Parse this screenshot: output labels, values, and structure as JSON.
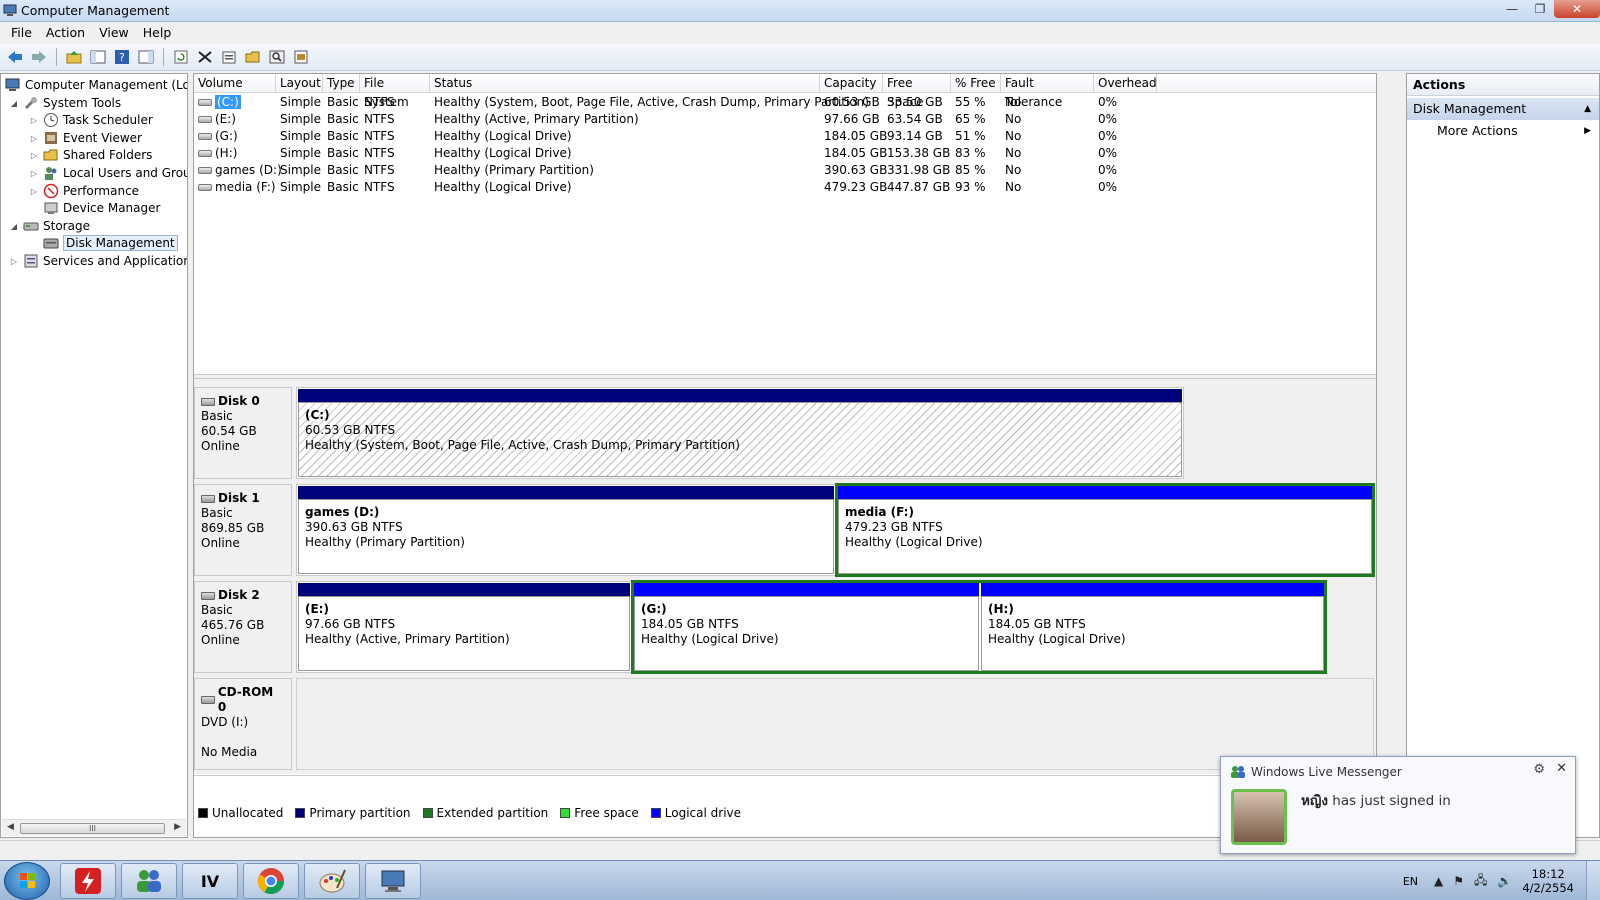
{
  "window": {
    "title": "Computer Management",
    "controls": {
      "minimize": "—",
      "maximize": "❐",
      "close": "✕"
    }
  },
  "menu": [
    "File",
    "Action",
    "View",
    "Help"
  ],
  "toolbar": {
    "icons": [
      "back-icon",
      "forward-icon",
      "up-folder-icon",
      "show-hide-tree-icon",
      "help-icon",
      "show-hide-action-pane-icon",
      "refresh-icon",
      "delete-icon",
      "properties-icon",
      "open-icon",
      "search-icon",
      "export-icon"
    ]
  },
  "tree": {
    "root": "Computer Management (Local",
    "system_tools": "System Tools",
    "task_scheduler": "Task Scheduler",
    "event_viewer": "Event Viewer",
    "shared_folders": "Shared Folders",
    "local_users": "Local Users and Groups",
    "performance": "Performance",
    "device_manager": "Device Manager",
    "storage": "Storage",
    "disk_management": "Disk Management",
    "services": "Services and Applications",
    "scroll_grip": "III"
  },
  "volumes": {
    "headers": [
      "Volume",
      "Layout",
      "Type",
      "File System",
      "Status",
      "Capacity",
      "Free Space",
      "% Free",
      "Fault Tolerance",
      "Overhead"
    ],
    "rows": [
      [
        "(C:)",
        "Simple",
        "Basic",
        "NTFS",
        "Healthy (System, Boot, Page File, Active, Crash Dump, Primary Partition)",
        "60.53 GB",
        "33.50 GB",
        "55 %",
        "No",
        "0%"
      ],
      [
        "(E:)",
        "Simple",
        "Basic",
        "NTFS",
        "Healthy (Active, Primary Partition)",
        "97.66 GB",
        "63.54 GB",
        "65 %",
        "No",
        "0%"
      ],
      [
        "(G:)",
        "Simple",
        "Basic",
        "NTFS",
        "Healthy (Logical Drive)",
        "184.05 GB",
        "93.14 GB",
        "51 %",
        "No",
        "0%"
      ],
      [
        "(H:)",
        "Simple",
        "Basic",
        "NTFS",
        "Healthy (Logical Drive)",
        "184.05 GB",
        "153.38 GB",
        "83 %",
        "No",
        "0%"
      ],
      [
        "games (D:)",
        "Simple",
        "Basic",
        "NTFS",
        "Healthy (Primary Partition)",
        "390.63 GB",
        "331.98 GB",
        "85 %",
        "No",
        "0%"
      ],
      [
        "media (F:)",
        "Simple",
        "Basic",
        "NTFS",
        "Healthy (Logical Drive)",
        "479.23 GB",
        "447.87 GB",
        "93 %",
        "No",
        "0%"
      ]
    ]
  },
  "disks": [
    {
      "name": "Disk 0",
      "type": "Basic",
      "size": "60.54 GB",
      "state": "Online",
      "partitions": [
        {
          "name": "(C:)",
          "size": "60.53 GB NTFS",
          "status": "Healthy (System, Boot, Page File, Active, Crash Dump, Primary Partition)",
          "kind": "primary"
        }
      ]
    },
    {
      "name": "Disk 1",
      "type": "Basic",
      "size": "869.85 GB",
      "state": "Online",
      "partitions": [
        {
          "name": "games  (D:)",
          "size": "390.63 GB NTFS",
          "status": "Healthy (Primary Partition)",
          "kind": "primary"
        },
        {
          "name": "media  (F:)",
          "size": "479.23 GB NTFS",
          "status": "Healthy (Logical Drive)",
          "kind": "logical"
        }
      ]
    },
    {
      "name": "Disk 2",
      "type": "Basic",
      "size": "465.76 GB",
      "state": "Online",
      "partitions": [
        {
          "name": "(E:)",
          "size": "97.66 GB NTFS",
          "status": "Healthy (Active, Primary Partition)",
          "kind": "primary"
        },
        {
          "name": "(G:)",
          "size": "184.05 GB NTFS",
          "status": "Healthy (Logical Drive)",
          "kind": "logical"
        },
        {
          "name": "(H:)",
          "size": "184.05 GB NTFS",
          "status": "Healthy (Logical Drive)",
          "kind": "logical"
        }
      ]
    },
    {
      "name": "CD-ROM 0",
      "type": "DVD (I:)",
      "state": "No Media"
    }
  ],
  "legend": [
    {
      "label": "Unallocated",
      "color": "#000000"
    },
    {
      "label": "Primary partition",
      "color": "#00007a"
    },
    {
      "label": "Extended partition",
      "color": "#1e7a1e"
    },
    {
      "label": "Free space",
      "color": "#33dd33"
    },
    {
      "label": "Logical drive",
      "color": "#0000ff"
    }
  ],
  "actions": {
    "title": "Actions",
    "section": "Disk Management",
    "more": "More Actions"
  },
  "toast": {
    "app": "Windows Live Messenger",
    "contact": "หญิง",
    "message": " has just signed in"
  },
  "taskbar": {
    "apps": [
      "flash-app-icon",
      "messenger-app-icon",
      "gta-iv-app-icon",
      "chrome-app-icon",
      "paint-app-icon",
      "computer-management-app-icon"
    ],
    "gta_label": "IV",
    "lang": "EN",
    "time": "18:12",
    "date": "4/2/2554"
  },
  "colors": {
    "primary": "#00007a",
    "logical": "#0000ff",
    "extended": "#1e7a1e",
    "selection": "#3399ff"
  }
}
